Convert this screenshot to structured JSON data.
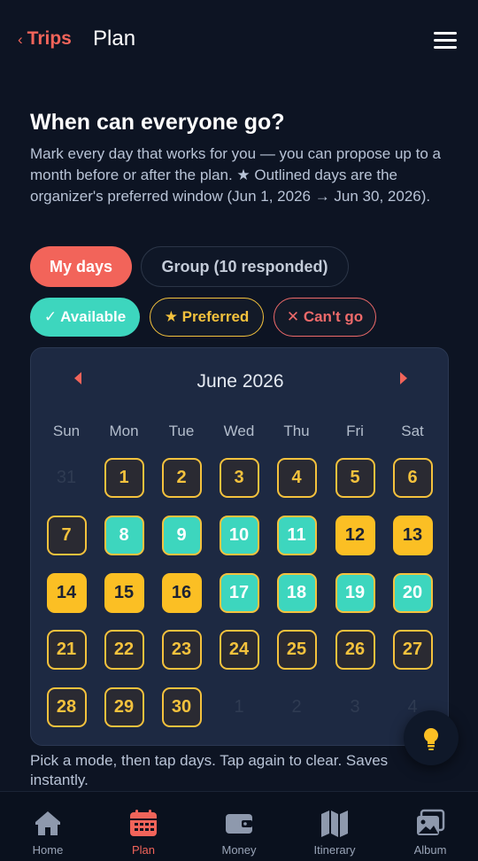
{
  "topbar": {
    "back_label": "Trips",
    "title": "Plan"
  },
  "intro": {
    "heading": "When can everyone go?",
    "description": "Mark every day that works for you — you can propose up to a month before or after the plan. ★ Outlined days are the organizer's preferred window (Jun 1, 2026 → Jun 30, 2026)."
  },
  "modes": {
    "my_days": "My days",
    "group": "Group (10 responded)"
  },
  "chips": {
    "available": "✓ Available",
    "preferred": "★ Preferred",
    "cant_go": "✕ Can't go"
  },
  "calendar": {
    "month_label": "June 2026",
    "weekdays": [
      "Sun",
      "Mon",
      "Tue",
      "Wed",
      "Thu",
      "Fri",
      "Sat"
    ],
    "days": [
      {
        "label": "31",
        "state": "out"
      },
      {
        "label": "1",
        "state": "preferred"
      },
      {
        "label": "2",
        "state": "preferred"
      },
      {
        "label": "3",
        "state": "preferred"
      },
      {
        "label": "4",
        "state": "preferred"
      },
      {
        "label": "5",
        "state": "preferred"
      },
      {
        "label": "6",
        "state": "preferred"
      },
      {
        "label": "7",
        "state": "preferred"
      },
      {
        "label": "8",
        "state": "available"
      },
      {
        "label": "9",
        "state": "available"
      },
      {
        "label": "10",
        "state": "available"
      },
      {
        "label": "11",
        "state": "available"
      },
      {
        "label": "12",
        "state": "highlight"
      },
      {
        "label": "13",
        "state": "highlight"
      },
      {
        "label": "14",
        "state": "highlight"
      },
      {
        "label": "15",
        "state": "highlight"
      },
      {
        "label": "16",
        "state": "highlight"
      },
      {
        "label": "17",
        "state": "available"
      },
      {
        "label": "18",
        "state": "available"
      },
      {
        "label": "19",
        "state": "available"
      },
      {
        "label": "20",
        "state": "available"
      },
      {
        "label": "21",
        "state": "preferred"
      },
      {
        "label": "22",
        "state": "preferred"
      },
      {
        "label": "23",
        "state": "preferred"
      },
      {
        "label": "24",
        "state": "preferred"
      },
      {
        "label": "25",
        "state": "preferred"
      },
      {
        "label": "26",
        "state": "preferred"
      },
      {
        "label": "27",
        "state": "preferred"
      },
      {
        "label": "28",
        "state": "preferred"
      },
      {
        "label": "29",
        "state": "preferred"
      },
      {
        "label": "30",
        "state": "preferred"
      },
      {
        "label": "1",
        "state": "out"
      },
      {
        "label": "2",
        "state": "out"
      },
      {
        "label": "3",
        "state": "out"
      },
      {
        "label": "4",
        "state": "out"
      }
    ]
  },
  "hint": "Pick a mode, then tap days. Tap again to clear. Saves instantly.",
  "nav": {
    "items": [
      {
        "label": "Home",
        "icon": "home-icon",
        "active": false
      },
      {
        "label": "Plan",
        "icon": "calendar-icon",
        "active": true
      },
      {
        "label": "Money",
        "icon": "wallet-icon",
        "active": false
      },
      {
        "label": "Itinerary",
        "icon": "map-icon",
        "active": false
      },
      {
        "label": "Album",
        "icon": "photo-icon",
        "active": false
      }
    ]
  },
  "colors": {
    "accent": "#f2645a",
    "available": "#3dd6be",
    "preferred": "#f4c23d",
    "cant_go": "#ee6a6a",
    "background": "#0d1423"
  }
}
